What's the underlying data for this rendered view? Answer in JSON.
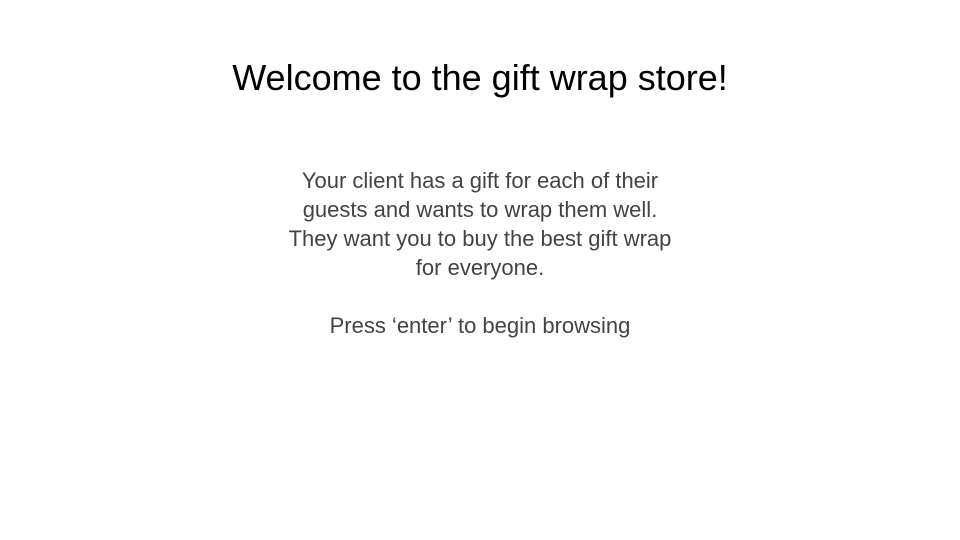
{
  "slide": {
    "title": "Welcome to the gift wrap store!",
    "description_lines": [
      "Your client has a gift for each of their",
      "guests and wants to wrap them well.",
      "They want you to buy the best gift wrap",
      "for everyone."
    ],
    "instruction": "Press ‘enter’ to begin browsing"
  },
  "colors": {
    "background": "#ffffff",
    "title": "#000000",
    "body_text": "#434343"
  }
}
